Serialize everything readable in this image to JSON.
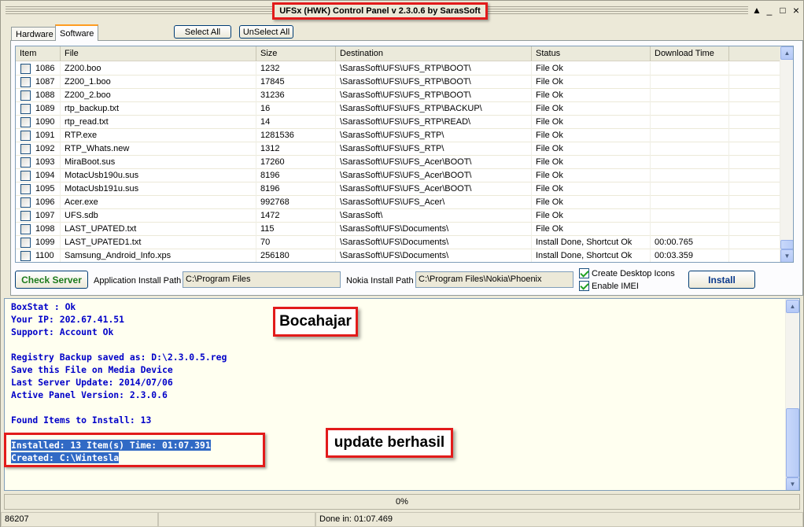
{
  "window": {
    "title": "UFSx (HWK) Control Panel v 2.3.0.6 by SarasSoft",
    "controls": [
      "▲",
      "_",
      "□",
      "×"
    ]
  },
  "tabs": [
    {
      "label": "Hardware"
    },
    {
      "label": "Software"
    }
  ],
  "toolbar": {
    "select_all": "Select All",
    "unselect_all": "UnSelect All"
  },
  "table": {
    "columns": [
      "Item",
      "File",
      "Size",
      "Destination",
      "Status",
      "Download Time"
    ],
    "rows": [
      {
        "item": "1086",
        "file": "Z200.boo",
        "size": "1232",
        "dest": "\\SarasSoft\\UFS\\UFS_RTP\\BOOT\\",
        "status": "File Ok",
        "time": ""
      },
      {
        "item": "1087",
        "file": "Z200_1.boo",
        "size": "17845",
        "dest": "\\SarasSoft\\UFS\\UFS_RTP\\BOOT\\",
        "status": "File Ok",
        "time": ""
      },
      {
        "item": "1088",
        "file": "Z200_2.boo",
        "size": "31236",
        "dest": "\\SarasSoft\\UFS\\UFS_RTP\\BOOT\\",
        "status": "File Ok",
        "time": ""
      },
      {
        "item": "1089",
        "file": "rtp_backup.txt",
        "size": "16",
        "dest": "\\SarasSoft\\UFS\\UFS_RTP\\BACKUP\\",
        "status": "File Ok",
        "time": ""
      },
      {
        "item": "1090",
        "file": "rtp_read.txt",
        "size": "14",
        "dest": "\\SarasSoft\\UFS\\UFS_RTP\\READ\\",
        "status": "File Ok",
        "time": ""
      },
      {
        "item": "1091",
        "file": "RTP.exe",
        "size": "1281536",
        "dest": "\\SarasSoft\\UFS\\UFS_RTP\\",
        "status": "File Ok",
        "time": ""
      },
      {
        "item": "1092",
        "file": "RTP_Whats.new",
        "size": "1312",
        "dest": "\\SarasSoft\\UFS\\UFS_RTP\\",
        "status": "File Ok",
        "time": ""
      },
      {
        "item": "1093",
        "file": "MiraBoot.sus",
        "size": "17260",
        "dest": "\\SarasSoft\\UFS\\UFS_Acer\\BOOT\\",
        "status": "File Ok",
        "time": ""
      },
      {
        "item": "1094",
        "file": "MotacUsb190u.sus",
        "size": "8196",
        "dest": "\\SarasSoft\\UFS\\UFS_Acer\\BOOT\\",
        "status": "File Ok",
        "time": ""
      },
      {
        "item": "1095",
        "file": "MotacUsb191u.sus",
        "size": "8196",
        "dest": "\\SarasSoft\\UFS\\UFS_Acer\\BOOT\\",
        "status": "File Ok",
        "time": ""
      },
      {
        "item": "1096",
        "file": "Acer.exe",
        "size": "992768",
        "dest": "\\SarasSoft\\UFS\\UFS_Acer\\",
        "status": "File Ok",
        "time": ""
      },
      {
        "item": "1097",
        "file": "UFS.sdb",
        "size": "1472",
        "dest": "\\SarasSoft\\",
        "status": "File Ok",
        "time": ""
      },
      {
        "item": "1098",
        "file": "LAST_UPATED.txt",
        "size": "115",
        "dest": "\\SarasSoft\\UFS\\Documents\\",
        "status": "File Ok",
        "time": ""
      },
      {
        "item": "1099",
        "file": "LAST_UPATED1.txt",
        "size": "70",
        "dest": "\\SarasSoft\\UFS\\Documents\\",
        "status": "Install Done, Shortcut Ok",
        "time": "00:00.765"
      },
      {
        "item": "1100",
        "file": "Samsung_Android_Info.xps",
        "size": "256180",
        "dest": "\\SarasSoft\\UFS\\Documents\\",
        "status": "Install Done, Shortcut Ok",
        "time": "00:03.359"
      }
    ]
  },
  "install_bar": {
    "check_server": "Check Server",
    "app_path_label": "Application Install Path",
    "app_path_value": "C:\\Program Files",
    "nokia_path_label": "Nokia Install Path",
    "nokia_path_value": "C:\\Program Files\\Nokia\\Phoenix",
    "create_icons": "Create Desktop Icons",
    "enable_imei": "Enable IMEI",
    "install": "Install"
  },
  "log": {
    "lines": [
      "BoxStat : Ok",
      "Your IP: 202.67.41.51",
      "Support: Account Ok",
      "",
      "Registry Backup saved as: D:\\2.3.0.5.reg",
      "Save this File on Media Device",
      "Last Server Update: 2014/07/06",
      "Active Panel Version: 2.3.0.6",
      "",
      "Found Items to Install: 13",
      ""
    ],
    "selected_lines": [
      "Installed: 13 Item(s) Time: 01:07.391",
      "Created: C:\\Wintesla"
    ]
  },
  "annotations": {
    "top": "Bocahajar",
    "bottom": "update berhasil"
  },
  "progress": {
    "label": "0%",
    "value": 0
  },
  "statusbar": {
    "left": "86207",
    "middle": "",
    "right": "Done in: 01:07.469"
  },
  "colors": {
    "log_text": "#0000c8",
    "highlight": "#316ac5",
    "annotation_border": "#e21b1b",
    "check_server_text": "#1b7a1b"
  }
}
